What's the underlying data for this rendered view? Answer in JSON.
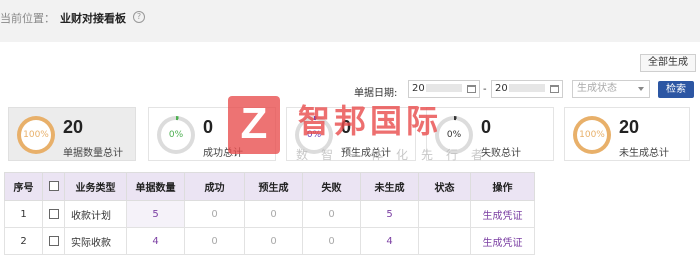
{
  "breadcrumb": {
    "prefix": "当前位置：",
    "title": "业财对接看板"
  },
  "toolbar": {
    "generate_all_label": "全部生成"
  },
  "filters": {
    "date_label": "单据日期:",
    "start_date_visible": "20",
    "end_date_visible": "20",
    "separator": "-",
    "status_placeholder": "生成状态",
    "search_label": "检索"
  },
  "cards": [
    {
      "percent": "100%",
      "value": "20",
      "label": "单据数量总计",
      "ring_color": "#e8b06a",
      "fill": 1.0
    },
    {
      "percent": "0%",
      "value": "0",
      "label": "成功总计",
      "ring_color": "#4caf50",
      "fill": 0.0
    },
    {
      "percent": "0%",
      "value": "0",
      "label": "预生成总计",
      "ring_color": "#6a3fb5",
      "fill": 0.0
    },
    {
      "percent": "0%",
      "value": "0",
      "label": "失败总计",
      "ring_color": "#333333",
      "fill": 0.0
    },
    {
      "percent": "100%",
      "value": "20",
      "label": "未生成总计",
      "ring_color": "#e8b06a",
      "fill": 1.0
    }
  ],
  "watermark": {
    "logo_letter": "Z",
    "title": "智邦国际",
    "subtitle": "数智一体化先行者"
  },
  "table": {
    "headers": [
      "序号",
      "",
      "业务类型",
      "单据数量",
      "成功",
      "预生成",
      "失败",
      "未生成",
      "状态",
      "操作"
    ],
    "rows": [
      {
        "index": "1",
        "type": "收款计划",
        "count": "5",
        "success": "0",
        "pre": "0",
        "fail": "0",
        "pending": "5",
        "status": "",
        "action": "生成凭证"
      },
      {
        "index": "2",
        "type": "实际收款",
        "count": "4",
        "success": "0",
        "pre": "0",
        "fail": "0",
        "pending": "4",
        "status": "",
        "action": "生成凭证"
      }
    ]
  },
  "colors": {
    "accent": "#2c56a3",
    "header_bg": "#ebe4f3",
    "link": "#7b3fa3"
  }
}
